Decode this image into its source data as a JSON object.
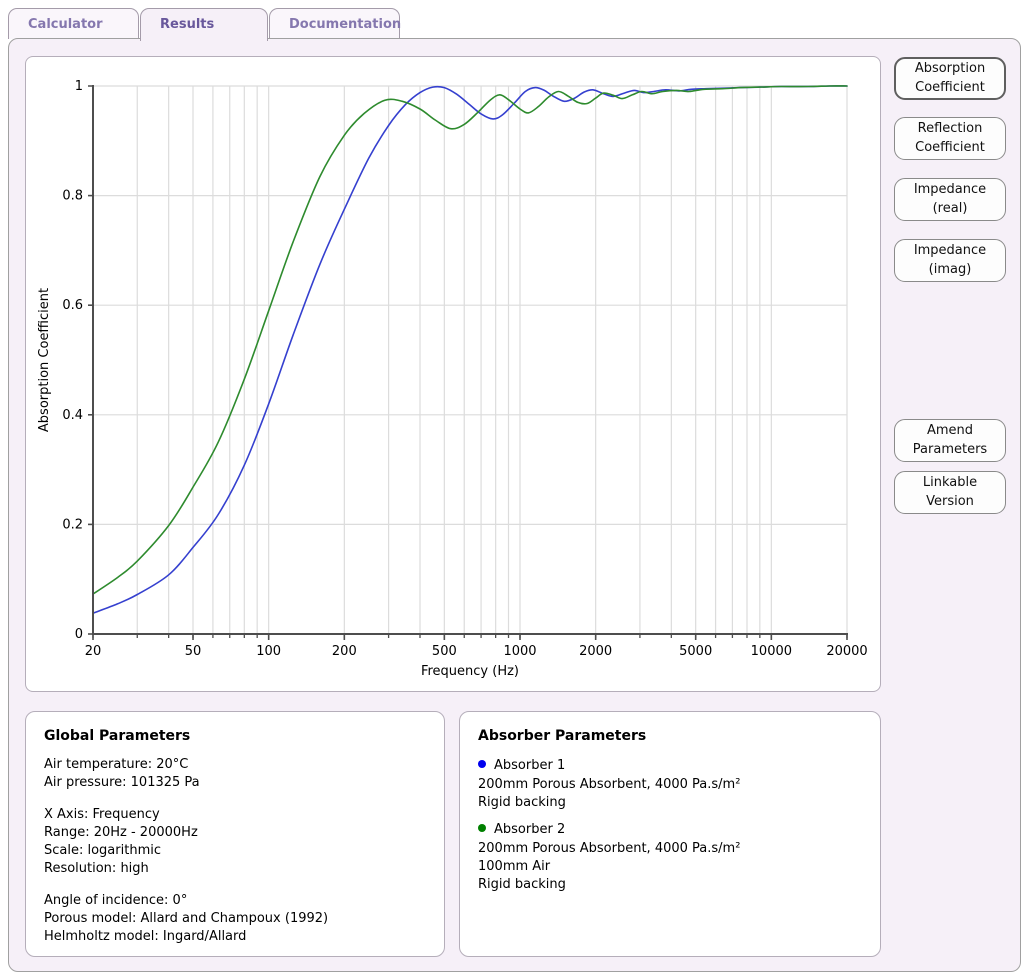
{
  "tabs": [
    {
      "label": "Calculator",
      "active": false
    },
    {
      "label": "Results",
      "active": true
    },
    {
      "label": "Documentation",
      "active": false
    }
  ],
  "view_buttons": [
    {
      "label": "Absorption\nCoefficient",
      "selected": true
    },
    {
      "label": "Reflection\nCoefficient",
      "selected": false
    },
    {
      "label": "Impedance\n(real)",
      "selected": false
    },
    {
      "label": "Impedance\n(imag)",
      "selected": false
    }
  ],
  "action_buttons": [
    {
      "label": "Amend\nParameters"
    },
    {
      "label": "Linkable\nVersion"
    }
  ],
  "global_params": {
    "title": "Global Parameters",
    "lines": [
      "Air temperature: 20°C",
      "Air pressure: 101325 Pa",
      "",
      "X Axis: Frequency",
      "Range: 20Hz - 20000Hz",
      "Scale: logarithmic",
      "Resolution: high",
      "",
      "Angle of incidence: 0°",
      "Porous model: Allard and Champoux (1992)",
      "Helmholtz model: Ingard/Allard"
    ]
  },
  "absorber_params": {
    "title": "Absorber Parameters",
    "absorbers": [
      {
        "name": "Absorber 1",
        "bullet_color": "#0000ee",
        "lines": [
          "200mm Porous Absorbent, 4000 Pa.s/m²",
          "Rigid backing"
        ]
      },
      {
        "name": "Absorber 2",
        "bullet_color": "#008000",
        "lines": [
          "200mm Porous Absorbent, 4000 Pa.s/m²",
          "100mm Air",
          "Rigid backing"
        ]
      }
    ]
  },
  "chart_data": {
    "type": "line",
    "title": "",
    "xlabel": "Frequency (Hz)",
    "ylabel": "Absorption Coefficient",
    "xscale": "log",
    "grid": true,
    "legend_position": "none",
    "xlim": [
      20,
      20000
    ],
    "ylim": [
      0,
      1
    ],
    "x_major_ticks": [
      20,
      50,
      100,
      200,
      500,
      1000,
      2000,
      5000,
      10000,
      20000
    ],
    "x_grid": [
      30,
      40,
      50,
      60,
      70,
      80,
      90,
      100,
      200,
      300,
      400,
      500,
      600,
      700,
      800,
      900,
      1000,
      2000,
      3000,
      4000,
      5000,
      6000,
      7000,
      8000,
      9000,
      10000,
      20000
    ],
    "y_ticks": [
      0,
      0.2,
      0.4,
      0.6,
      0.8,
      1
    ],
    "series": [
      {
        "name": "Absorber 1",
        "color": "#3540cf",
        "points": [
          [
            20,
            0.038
          ],
          [
            25,
            0.055
          ],
          [
            30,
            0.072
          ],
          [
            40,
            0.108
          ],
          [
            50,
            0.158
          ],
          [
            63,
            0.218
          ],
          [
            80,
            0.308
          ],
          [
            100,
            0.42
          ],
          [
            125,
            0.545
          ],
          [
            160,
            0.675
          ],
          [
            200,
            0.775
          ],
          [
            250,
            0.868
          ],
          [
            300,
            0.928
          ],
          [
            350,
            0.966
          ],
          [
            400,
            0.988
          ],
          [
            450,
            0.998
          ],
          [
            500,
            0.997
          ],
          [
            560,
            0.985
          ],
          [
            630,
            0.966
          ],
          [
            700,
            0.949
          ],
          [
            780,
            0.94
          ],
          [
            850,
            0.947
          ],
          [
            950,
            0.969
          ],
          [
            1050,
            0.99
          ],
          [
            1150,
            0.997
          ],
          [
            1250,
            0.992
          ],
          [
            1350,
            0.982
          ],
          [
            1500,
            0.972
          ],
          [
            1650,
            0.978
          ],
          [
            1800,
            0.989
          ],
          [
            1950,
            0.993
          ],
          [
            2150,
            0.986
          ],
          [
            2350,
            0.981
          ],
          [
            2600,
            0.987
          ],
          [
            2850,
            0.992
          ],
          [
            3100,
            0.988
          ],
          [
            3400,
            0.99
          ],
          [
            3800,
            0.993
          ],
          [
            4300,
            0.991
          ],
          [
            4800,
            0.994
          ],
          [
            5500,
            0.995
          ],
          [
            6500,
            0.996
          ],
          [
            7500,
            0.997
          ],
          [
            9000,
            0.998
          ],
          [
            11000,
            0.999
          ],
          [
            14000,
            0.999
          ],
          [
            17000,
            1.0
          ],
          [
            20000,
            1.0
          ]
        ]
      },
      {
        "name": "Absorber 2",
        "color": "#2e8b2e",
        "points": [
          [
            20,
            0.073
          ],
          [
            25,
            0.103
          ],
          [
            30,
            0.133
          ],
          [
            40,
            0.198
          ],
          [
            50,
            0.268
          ],
          [
            63,
            0.35
          ],
          [
            80,
            0.465
          ],
          [
            100,
            0.59
          ],
          [
            125,
            0.715
          ],
          [
            160,
            0.835
          ],
          [
            200,
            0.91
          ],
          [
            240,
            0.95
          ],
          [
            290,
            0.974
          ],
          [
            340,
            0.972
          ],
          [
            400,
            0.958
          ],
          [
            460,
            0.938
          ],
          [
            530,
            0.922
          ],
          [
            600,
            0.93
          ],
          [
            680,
            0.952
          ],
          [
            760,
            0.974
          ],
          [
            830,
            0.984
          ],
          [
            900,
            0.975
          ],
          [
            1000,
            0.958
          ],
          [
            1080,
            0.951
          ],
          [
            1180,
            0.962
          ],
          [
            1300,
            0.98
          ],
          [
            1420,
            0.99
          ],
          [
            1550,
            0.982
          ],
          [
            1700,
            0.97
          ],
          [
            1850,
            0.968
          ],
          [
            2000,
            0.978
          ],
          [
            2150,
            0.987
          ],
          [
            2350,
            0.983
          ],
          [
            2550,
            0.977
          ],
          [
            2800,
            0.984
          ],
          [
            3050,
            0.99
          ],
          [
            3350,
            0.986
          ],
          [
            3700,
            0.99
          ],
          [
            4200,
            0.992
          ],
          [
            4700,
            0.99
          ],
          [
            5400,
            0.994
          ],
          [
            6400,
            0.995
          ],
          [
            7500,
            0.997
          ],
          [
            9000,
            0.998
          ],
          [
            11000,
            0.999
          ],
          [
            14000,
            0.999
          ],
          [
            17000,
            1.0
          ],
          [
            20000,
            1.0
          ]
        ]
      }
    ]
  },
  "colors": {
    "page_background": "#ffffff",
    "container_background": "#f6f0f8",
    "panel_background": "#ffffff",
    "tab_text": "#8577ae",
    "tab_text_active": "#69589c",
    "grid": "#dcdcdc",
    "axis": "#4d4d4d",
    "series_1": "#3540cf",
    "series_2": "#2e8b2e"
  }
}
